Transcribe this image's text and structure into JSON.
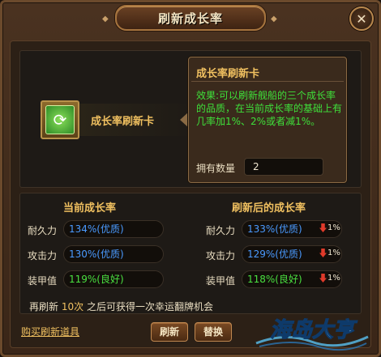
{
  "window": {
    "title": "刷新成长率",
    "close": "✕"
  },
  "item": {
    "name": "成长率刷新卡",
    "icon": "refresh-card-icon"
  },
  "tooltip": {
    "title": "成长率刷新卡",
    "description": "效果:可以刷新舰船的三个成长率的品质，在当前成长率的基础上有几率加1%、2%或者减1%。",
    "count_label": "拥有数量",
    "count_value": "2"
  },
  "current": {
    "heading": "当前成长率",
    "stats": [
      {
        "label": "耐久力",
        "value": "134%(优质)",
        "color": "#4a9aff"
      },
      {
        "label": "攻击力",
        "value": "130%(优质)",
        "color": "#4a9aff"
      },
      {
        "label": "装甲值",
        "value": "119%(良好)",
        "color": "#4ae040"
      }
    ]
  },
  "refreshed": {
    "heading": "刷新后的成长率",
    "stats": [
      {
        "label": "耐久力",
        "value": "133%(优质)",
        "color": "#4a9aff",
        "delta": "1%"
      },
      {
        "label": "攻击力",
        "value": "129%(优质)",
        "color": "#4a9aff",
        "delta": "1%"
      },
      {
        "label": "装甲值",
        "value": "118%(良好)",
        "color": "#4ae040",
        "delta": "1%"
      }
    ]
  },
  "footer": {
    "refresh_prefix": "再刷新",
    "refresh_count": "10次",
    "refresh_suffix": "之后可获得一次幸运翻牌机会",
    "buy_link": "购买刷新道具",
    "refresh_button": "刷新",
    "swap_button": "替换"
  },
  "logo": {
    "text": "海岛大亨"
  }
}
